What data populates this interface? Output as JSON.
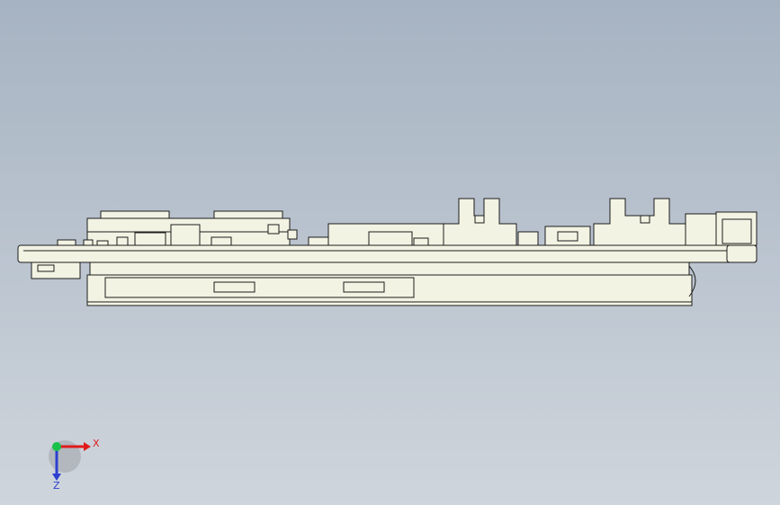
{
  "viewport": {
    "background_top": "#a6b3c2",
    "background_bottom": "#cfd5dc",
    "part_fill": "#f3f3e4",
    "part_stroke": "#1c1c1c"
  },
  "triad": {
    "x_label": "X",
    "z_label": "Z",
    "x_color": "#e01b1b",
    "z_color": "#2c3fd0",
    "y_color": "#19c24a"
  }
}
